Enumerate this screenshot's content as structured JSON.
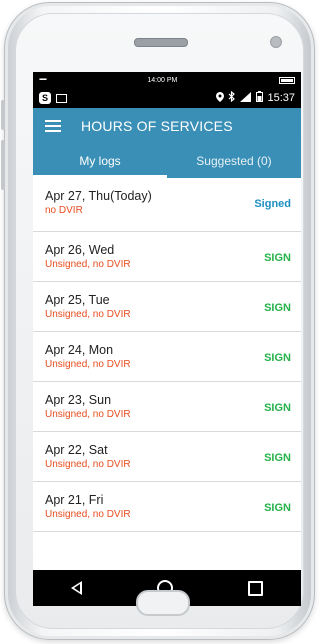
{
  "device": {
    "outer_status": {
      "time": "14:00 PM",
      "signal": "▪▪▪▪▪▪"
    },
    "android_status": {
      "time": "15:37"
    }
  },
  "appbar": {
    "title": "HOURS OF SERVICES"
  },
  "tabs": [
    {
      "label": "My logs",
      "active": true
    },
    {
      "label": "Suggested (0)",
      "active": false
    }
  ],
  "logs": [
    {
      "date": "Apr 27, Thu(Today)",
      "status": "no DVIR",
      "action": "Signed"
    },
    {
      "date": "Apr 26, Wed",
      "status": "Unsigned, no DVIR",
      "action": "SIGN"
    },
    {
      "date": "Apr 25, Tue",
      "status": "Unsigned, no DVIR",
      "action": "SIGN"
    },
    {
      "date": "Apr 24, Mon",
      "status": "Unsigned, no DVIR",
      "action": "SIGN"
    },
    {
      "date": "Apr 23, Sun",
      "status": "Unsigned, no DVIR",
      "action": "SIGN"
    },
    {
      "date": "Apr 22, Sat",
      "status": "Unsigned, no DVIR",
      "action": "SIGN"
    },
    {
      "date": "Apr 21, Fri",
      "status": "Unsigned, no DVIR",
      "action": "SIGN"
    }
  ],
  "colors": {
    "appbar": "#3a8fb7",
    "signed": "#1d8fc1",
    "sign": "#27b24a",
    "warning_text": "#e74c1e"
  }
}
